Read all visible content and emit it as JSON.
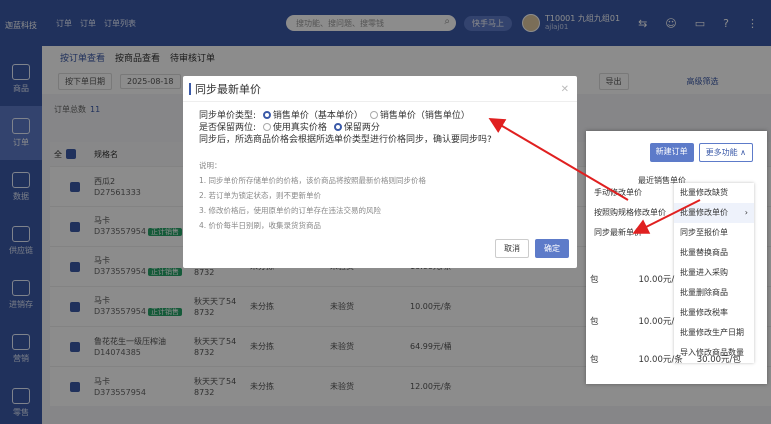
{
  "app": {
    "logo": "迦蓝科技"
  },
  "sidebar": {
    "items": [
      {
        "label": "商品"
      },
      {
        "label": "订单"
      },
      {
        "label": "数据"
      },
      {
        "label": "供应链"
      },
      {
        "label": "进销存"
      },
      {
        "label": "营销"
      },
      {
        "label": "零售"
      }
    ]
  },
  "header": {
    "breadcrumb": [
      "订单",
      "订单",
      "订单列表"
    ],
    "search_placeholder": "搜功能、搜问题、搜零钱",
    "quick_label": "快手马上",
    "user_name": "T10001 九组九组01",
    "user_sub": "ajlaj01"
  },
  "tabs": [
    "按订单查看",
    "按商品查看",
    "待审核订单"
  ],
  "filters": {
    "date_type": "按下单日期",
    "date_value": "2025-08-18",
    "export": "导出",
    "advanced": "高级筛选"
  },
  "count": {
    "label": "订单总数",
    "value": "11"
  },
  "table": {
    "headers": [
      "全",
      "规格名"
    ],
    "rows": [
      {
        "name": "西瓜2",
        "code": "D27561333",
        "tag": "",
        "supplier": "",
        "c3": "",
        "c4": "",
        "c5": ""
      },
      {
        "name": "马卡",
        "code": "D373557954",
        "tag": "正计销售",
        "supplier": "",
        "c3": "",
        "c4": "",
        "c5": ""
      },
      {
        "name": "马卡",
        "code": "D373557954",
        "tag": "正计销售",
        "supplier": "秋天天了54 8732",
        "c3": "未分拣",
        "c4": "未验货",
        "c5": "10.00元/条"
      },
      {
        "name": "马卡",
        "code": "D373557954",
        "tag": "正计销售",
        "supplier": "秋天天了54 8732",
        "c3": "未分拣",
        "c4": "未验货",
        "c5": "10.00元/条"
      },
      {
        "name": "鲁花花生一级压榨油",
        "code": "D14074385",
        "tag": "",
        "supplier": "秋天天了54 8732",
        "c3": "未分拣",
        "c4": "未验货",
        "c5": "64.99元/桶"
      },
      {
        "name": "马卡",
        "code": "D373557954",
        "tag": "",
        "supplier": "秋天天了54 8732",
        "c3": "未分拣",
        "c4": "未验货",
        "c5": "12.00元/条"
      }
    ]
  },
  "modal": {
    "title": "同步最新单价",
    "line1_label": "同步单价类型:",
    "opt1": "销售单价（基本单价）",
    "opt2": "销售单价（销售单位）",
    "line2_label": "是否保留两位:",
    "opt3": "使用真实价格",
    "opt4": "保留两分",
    "line3": "同步后，所选商品价格会根据所选单价类型进行价格同步，确认要同步吗?",
    "notes_title": "说明：",
    "notes": [
      "1. 同步单价所存储单价的价格，该价商品将按照最新价格则同步价格",
      "2. 若订单为锁定状态，则不更新单价",
      "3. 修改价格后，使用原单价的订单存在违法交易的风险",
      "4. 价价每半日别刷，收集录货货商品"
    ],
    "cancel": "取消",
    "confirm": "确定"
  },
  "zoom": {
    "btn_new": "新建订单",
    "btn_more": "更多功能 ∧",
    "header": "最近销售单价",
    "menu1": [
      "手动修改单价",
      "按照购规格修改单价",
      "同步最新单价"
    ],
    "menu2": [
      "批量修改缺货",
      "批量修改单价",
      "同步至报价单",
      "批量替换商品",
      "批量进入采购",
      "批量删除商品",
      "批量修改税率",
      "批量修改生产日期",
      "导入修改商品数量"
    ],
    "row_vals": [
      {
        "unit": "包",
        "price": "10.00元/"
      },
      {
        "unit": "包",
        "price": "10.00元/"
      },
      {
        "unit": "包",
        "price": "10.00元/条",
        "total": "30.00元/包"
      }
    ]
  }
}
